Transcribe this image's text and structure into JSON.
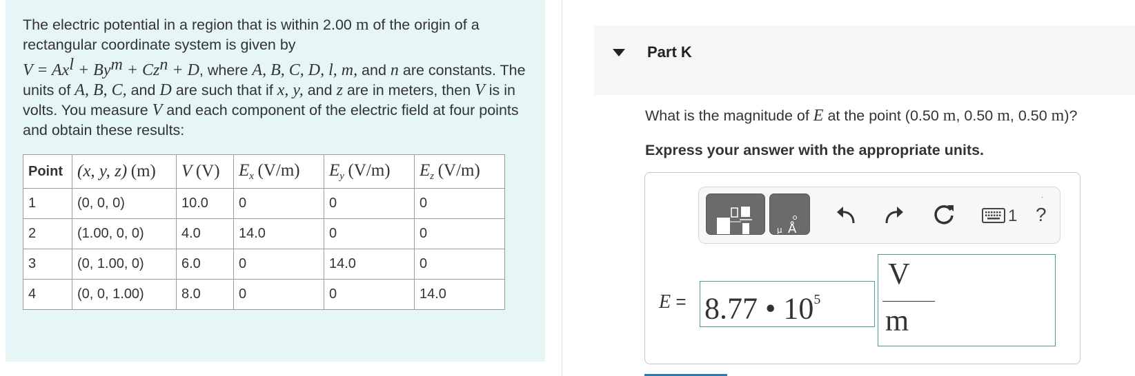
{
  "intro": {
    "line1_text": "The electric potential in a region that is within 2.00 ",
    "line1_unit": "m",
    "line1_end": " of the origin of a rectangular coordinate system is given by",
    "formula": "V = Ax",
    "formula_l": "l",
    "formula_mid1": " + By",
    "formula_m": "m",
    "formula_mid2": " + Cz",
    "formula_n": "n",
    "formula_end": " + D",
    "where_text": ", where ",
    "constants_list": "A, B, C, D, l, m,",
    "and_text": " and ",
    "n_var": "n",
    "are_text": " are constants. The units of ",
    "abc_list": "A, B, C,",
    "and_d_text": " and ",
    "d_var": "D",
    "such_text": " are such that if ",
    "xy_list": "x, y,",
    "and_z_text": " and ",
    "z_var": "z",
    "meters_text": " are in meters, then ",
    "v_var": "V",
    "volts_text": " is in volts. You measure ",
    "v_var2": "V",
    "measure_end": " and each component of the electric field at four points and obtain these results:"
  },
  "table": {
    "headers": {
      "point": "Point",
      "xyz": "(x, y, z)",
      "xyz_unit": "(m)",
      "v": "V",
      "v_unit": "(V)",
      "ex": "E",
      "ex_sub": "x",
      "ex_unit": "(V/m)",
      "ey": "E",
      "ey_sub": "y",
      "ey_unit": "(V/m)",
      "ez": "E",
      "ez_sub": "z",
      "ez_unit": "(V/m)"
    },
    "rows": [
      {
        "point": "1",
        "xyz": "(0, 0, 0)",
        "v": "10.0",
        "ex": "0",
        "ey": "0",
        "ez": "0"
      },
      {
        "point": "2",
        "xyz": "(1.00, 0, 0)",
        "v": "4.0",
        "ex": "14.0",
        "ey": "0",
        "ez": "0"
      },
      {
        "point": "3",
        "xyz": "(0, 1.00, 0)",
        "v": "6.0",
        "ex": "0",
        "ey": "14.0",
        "ez": "0"
      },
      {
        "point": "4",
        "xyz": "(0, 0, 1.00)",
        "v": "8.0",
        "ex": "0",
        "ey": "0",
        "ez": "14.0"
      }
    ]
  },
  "part": {
    "title": "Part K",
    "question_start": "What is the magnitude of ",
    "question_var": "E",
    "question_mid": " at the point (0.50 ",
    "unit_m1": "m",
    "sep1": ", 0.50 ",
    "unit_m2": "m",
    "sep2": ", 0.50 ",
    "unit_m3": "m",
    "question_end": ")?",
    "instruction": "Express your answer with the appropriate units."
  },
  "answer": {
    "label_var": "E",
    "label_eq": " =",
    "value_mantissa": "8.77 • 10",
    "value_exponent": "5",
    "unit_numerator": "V",
    "unit_denominator": "m"
  },
  "toolbar": {
    "keyboard_count": "1",
    "help_label": "?",
    "dot": "."
  },
  "icons": {
    "toggle": "caret-down-icon",
    "templates": "templates-icon",
    "symbols": "symbols-icon",
    "undo": "undo-icon",
    "redo": "redo-icon",
    "reset": "reset-icon",
    "keyboard": "keyboard-icon",
    "help": "help-icon"
  },
  "colors": {
    "panel_bg": "#e6f5f5",
    "input_border": "#4a9a9a",
    "toolbar_button": "#6b6b6b"
  }
}
